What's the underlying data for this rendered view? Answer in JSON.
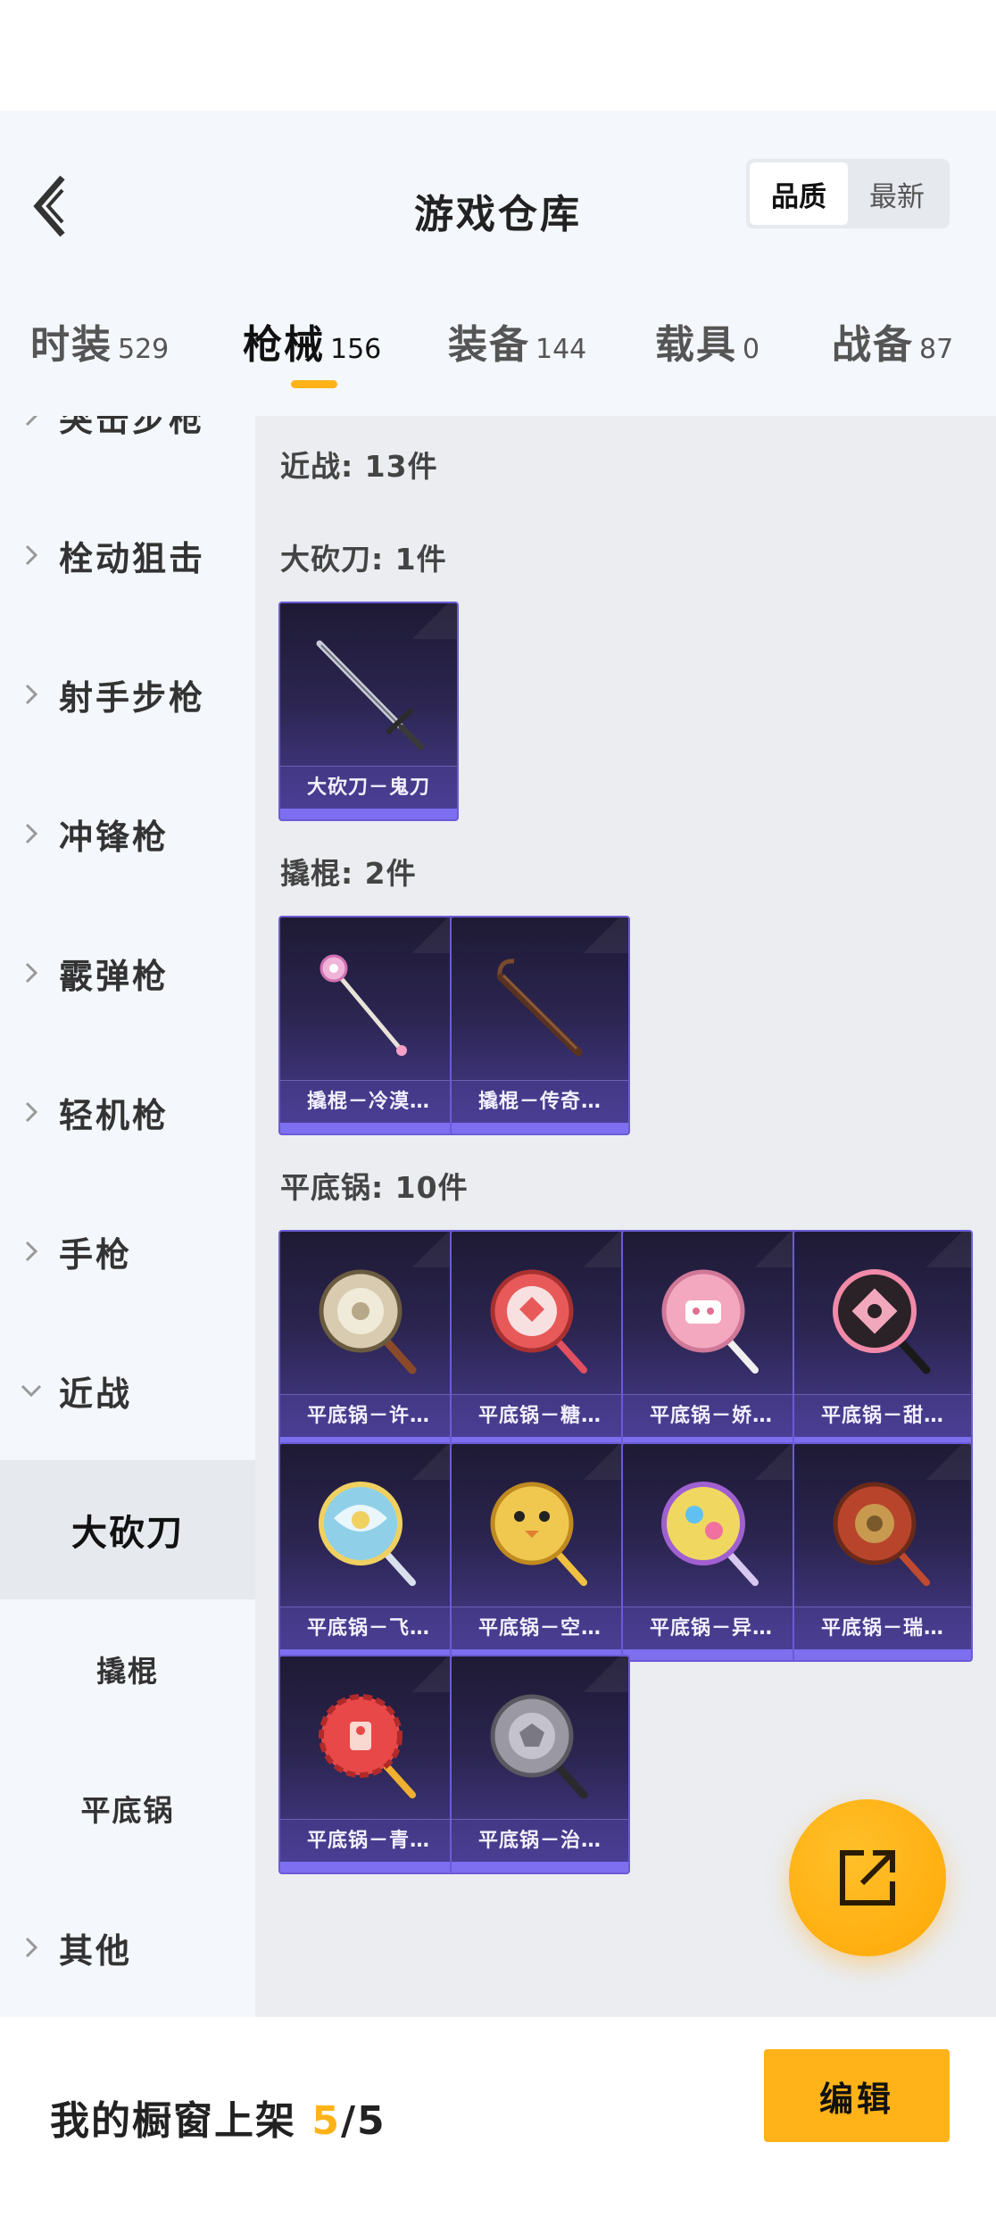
{
  "header": {
    "title": "游戏仓库",
    "sort_options": [
      "品质",
      "最新"
    ],
    "sort_selected": "品质"
  },
  "tabs": [
    {
      "label": "时装",
      "count": "529"
    },
    {
      "label": "枪械",
      "count": "156",
      "active": true
    },
    {
      "label": "装备",
      "count": "144"
    },
    {
      "label": "载具",
      "count": "0"
    },
    {
      "label": "战备",
      "count": "87"
    }
  ],
  "sidebar": {
    "categories": [
      "突击步枪",
      "栓动狙击",
      "射手步枪",
      "冲锋枪",
      "霰弹枪",
      "轻机枪",
      "手枪",
      "近战"
    ],
    "expanded": "近战",
    "subcategories": [
      "大砍刀",
      "撬棍",
      "平底锅"
    ],
    "selected_sub": "大砍刀",
    "last_category": "其他"
  },
  "content": {
    "summary": "近战: 13件",
    "groups": [
      {
        "title": "大砍刀: 1件",
        "items": [
          "大砍刀－鬼刀"
        ]
      },
      {
        "title": "撬棍: 2件",
        "items": [
          "撬棍－冷漠…",
          "撬棍－传奇…"
        ]
      },
      {
        "title": "平底锅: 10件",
        "items": [
          "平底锅－许…",
          "平底锅－糖…",
          "平底锅－娇…",
          "平底锅－甜…",
          "平底锅－飞…",
          "平底锅－空…",
          "平底锅－异…",
          "平底锅－瑞…",
          "平底锅－青…",
          "平底锅－治…"
        ]
      }
    ]
  },
  "bottom": {
    "showcase_label": "我的橱窗上架",
    "showcase_current": "5",
    "showcase_total": "/5",
    "edit_label": "编辑"
  },
  "icons": {
    "back": "chevron-left-icon",
    "share": "share-external-icon",
    "collapsed": "chevron-right-icon",
    "expanded": "chevron-down-icon"
  },
  "colors": {
    "accent": "#ffb318",
    "card_border": "#6b5bd6",
    "sidebar_bg": "#f4f7fb",
    "content_bg": "#ebedf0"
  }
}
